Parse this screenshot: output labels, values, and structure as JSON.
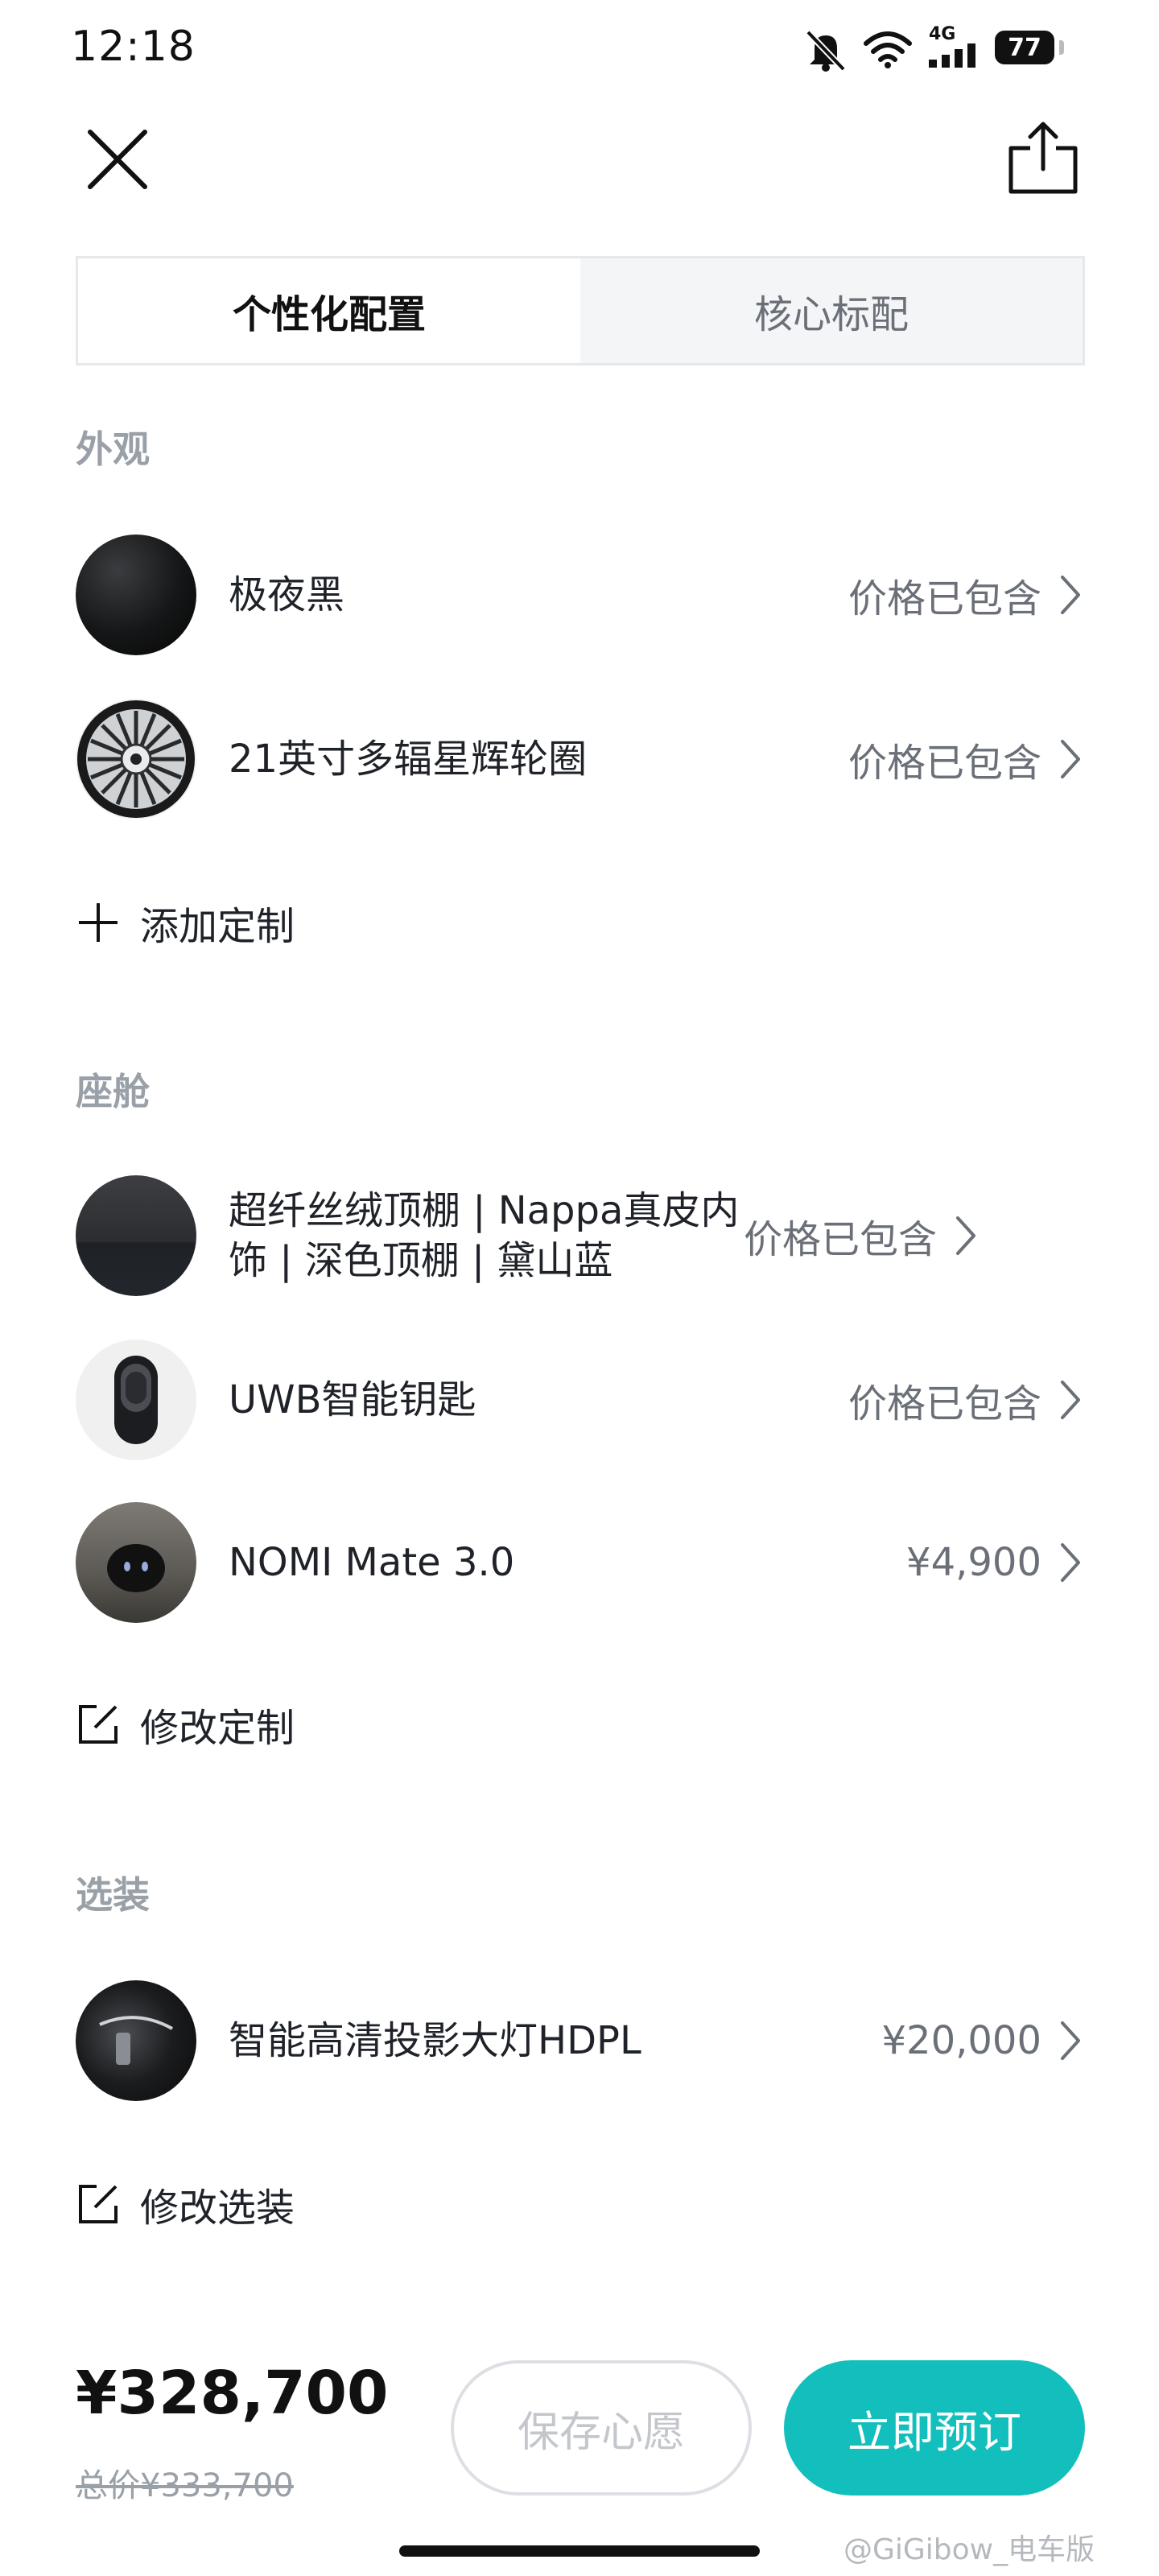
{
  "status_bar": {
    "time": "12:18",
    "network": "4G",
    "battery": "77"
  },
  "header": {
    "close_icon": "close-icon",
    "share_icon": "share-icon"
  },
  "tabs": [
    {
      "label": "个性化配置",
      "active": true
    },
    {
      "label": "核心标配",
      "active": false
    }
  ],
  "exterior": {
    "title": "外观",
    "items": [
      {
        "label": "极夜黑",
        "price": "价格已包含",
        "thumb": "paint-swatch-black"
      },
      {
        "label": "21英寸多辐星辉轮圈",
        "price": "价格已包含",
        "thumb": "wheel-rim"
      }
    ],
    "action_label": "添加定制",
    "action_icon": "plus-icon"
  },
  "cabin": {
    "title": "座舱",
    "items": [
      {
        "label": "超纤丝绒顶棚 | Nappa真皮内饰 | 深色顶棚 | 黛山蓝",
        "price": "价格已包含",
        "thumb": "interior-fabric"
      },
      {
        "label": "UWB智能钥匙",
        "price": "价格已包含",
        "thumb": "smart-key"
      },
      {
        "label": "NOMI Mate 3.0",
        "price": "¥4,900",
        "thumb": "nomi-robot"
      }
    ],
    "action_label": "修改定制",
    "action_icon": "edit-icon"
  },
  "options": {
    "title": "选装",
    "items": [
      {
        "label": "智能高清投影大灯HDPL",
        "price": "¥20,000",
        "thumb": "headlight"
      }
    ],
    "action_label": "修改选装",
    "action_icon": "edit-icon"
  },
  "footer": {
    "total_price": "¥328,700",
    "original_price": "总价¥333,700",
    "save_label": "保存心愿",
    "order_label": "立即预订"
  },
  "watermark": "@GiGibow_电车版",
  "colors": {
    "accent": "#13bfbd",
    "muted": "#9aa0a8",
    "text": "#1f2329"
  }
}
